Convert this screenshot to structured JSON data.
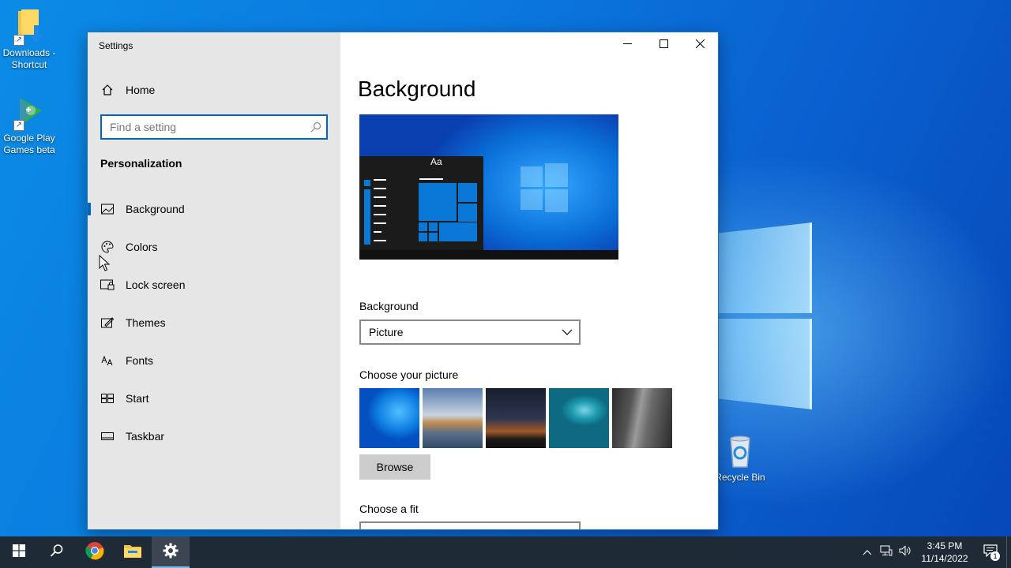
{
  "desktop": {
    "icons": [
      {
        "label": "Downloads - Shortcut"
      },
      {
        "label": "Google Play Games beta"
      },
      {
        "label": "Recycle Bin"
      }
    ]
  },
  "window": {
    "title": "Settings",
    "controls": {
      "minimize": "minimize-icon",
      "maximize": "maximize-icon",
      "close": "close-icon"
    }
  },
  "sidebar": {
    "home_label": "Home",
    "search_placeholder": "Find a setting",
    "group_title": "Personalization",
    "items": [
      {
        "label": "Background",
        "icon": "picture-icon",
        "active": true
      },
      {
        "label": "Colors",
        "icon": "palette-icon",
        "active": false
      },
      {
        "label": "Lock screen",
        "icon": "lock-screen-icon",
        "active": false
      },
      {
        "label": "Themes",
        "icon": "themes-icon",
        "active": false
      },
      {
        "label": "Fonts",
        "icon": "fonts-icon",
        "active": false
      },
      {
        "label": "Start",
        "icon": "start-icon",
        "active": false
      },
      {
        "label": "Taskbar",
        "icon": "taskbar-icon",
        "active": false
      }
    ]
  },
  "content": {
    "page_title": "Background",
    "preview_tile_text": "Aa",
    "background_label": "Background",
    "background_value": "Picture",
    "choose_picture_label": "Choose your picture",
    "browse_label": "Browse",
    "choose_fit_label": "Choose a fit"
  },
  "taskbar": {
    "clock_time": "3:45 PM",
    "clock_date": "11/14/2022",
    "notification_count": "1"
  },
  "colors": {
    "accent": "#0067c0",
    "taskbar": "#1e2a36",
    "sidebar_bg": "#e6e6e6"
  }
}
